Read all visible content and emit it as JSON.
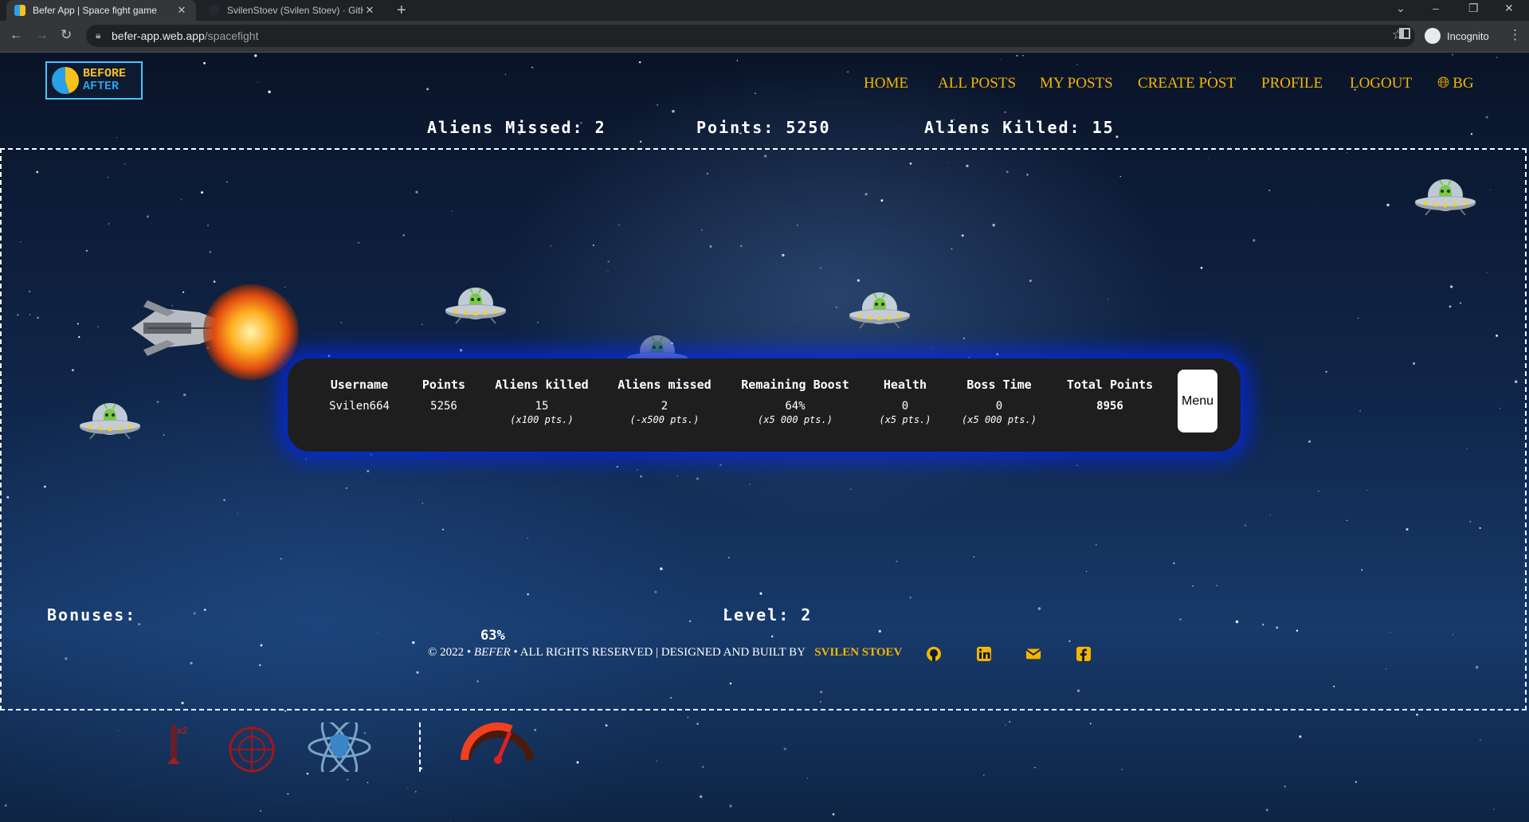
{
  "browser": {
    "tabs": [
      {
        "title": "Befer App | Space fight game",
        "active": true
      },
      {
        "title": "SvilenStoev (Svilen Stoev) · GitHub",
        "active": false
      }
    ],
    "url_host": "befer-app.web.app",
    "url_path": "/spacefight",
    "incognito_label": "Incognito"
  },
  "logo": {
    "line1": "BEFORE",
    "line2": "AFTER"
  },
  "nav": {
    "home": "HOME",
    "all_posts": "ALL POSTS",
    "my_posts": "MY POSTS",
    "create_post": "CREATE POST",
    "profile": "PROFILE",
    "logout": "LOGOUT",
    "language": "BG"
  },
  "hud": {
    "aliens_missed": "Aliens Missed: 2",
    "points": "Points: 5250",
    "aliens_killed": "Aliens Killed: 15"
  },
  "scorecard": {
    "columns": [
      {
        "header": "Username",
        "value": "Svilen664",
        "note": ""
      },
      {
        "header": "Points",
        "value": "5256",
        "note": ""
      },
      {
        "header": "Aliens killed",
        "value": "15",
        "note": "(x100 pts.)"
      },
      {
        "header": "Aliens missed",
        "value": "2",
        "note": "(-x500 pts.)"
      },
      {
        "header": "Remaining Boost",
        "value": "64%",
        "note": "(x5 000 pts.)"
      },
      {
        "header": "Health",
        "value": "0",
        "note": "(x5 pts.)"
      },
      {
        "header": "Boss Time",
        "value": "0",
        "note": "(x5 000 pts.)"
      },
      {
        "header": "Total Points",
        "value": "8956",
        "note": ""
      }
    ],
    "menu_label": "Menu"
  },
  "bonuses_label": "Bonuses:",
  "bonus_items": [
    "x2 rocket bonus",
    "crosshair bonus",
    "atom shield bonus"
  ],
  "boost": {
    "percent": "63%",
    "fraction": 0.63
  },
  "level": "Level: 2",
  "footer": {
    "copyright": "© 2022 •",
    "brand": "BEFER",
    "rights": "• ALL RIGHTS RESERVED | DESIGNED AND BUILT BY",
    "author": "SVILEN STOEV",
    "icons": [
      "github-icon",
      "linkedin-icon",
      "email-icon",
      "facebook-icon"
    ]
  },
  "colors": {
    "accent": "#f7b500",
    "scorecard_bg": "#1e1e1e",
    "glow": "#0028ff",
    "logo_blue": "#2aa0e8"
  }
}
